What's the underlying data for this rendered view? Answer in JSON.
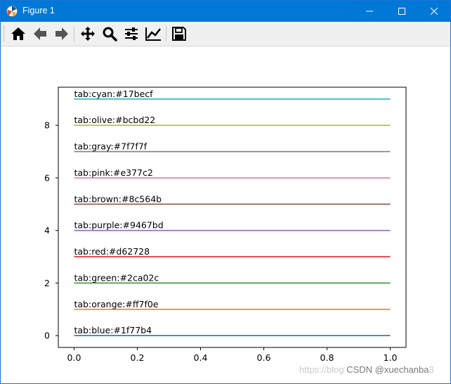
{
  "window": {
    "title": "Figure 1"
  },
  "toolbar": {
    "buttons": [
      {
        "name": "home-icon",
        "label": "Home"
      },
      {
        "name": "back-arrow-icon",
        "label": "Back"
      },
      {
        "name": "forward-arrow-icon",
        "label": "Forward"
      },
      {
        "name": "pan-icon",
        "label": "Pan"
      },
      {
        "name": "zoom-icon",
        "label": "Zoom"
      },
      {
        "name": "configure-subplots-icon",
        "label": "Subplots"
      },
      {
        "name": "edit-axis-icon",
        "label": "Customize"
      },
      {
        "name": "save-icon",
        "label": "Save"
      }
    ]
  },
  "chart_data": {
    "type": "line",
    "title": "",
    "xlabel": "",
    "ylabel": "",
    "xlim": [
      -0.05,
      1.05
    ],
    "ylim": [
      -0.45,
      9.45
    ],
    "x_ticks": [
      "0.0",
      "0.2",
      "0.4",
      "0.6",
      "0.8",
      "1.0"
    ],
    "x_tick_values": [
      0.0,
      0.2,
      0.4,
      0.6,
      0.8,
      1.0
    ],
    "y_ticks": [
      "0",
      "2",
      "4",
      "6",
      "8"
    ],
    "y_tick_values": [
      0,
      2,
      4,
      6,
      8
    ],
    "grid": false,
    "legend": "none",
    "series": [
      {
        "label": "tab:blue:#1f77b4",
        "color": "#1f77b4",
        "x": [
          0,
          1
        ],
        "y": [
          0,
          0
        ]
      },
      {
        "label": "tab:orange:#ff7f0e",
        "color": "#ff7f0e",
        "x": [
          0,
          1
        ],
        "y": [
          1,
          1
        ]
      },
      {
        "label": "tab:green:#2ca02c",
        "color": "#2ca02c",
        "x": [
          0,
          1
        ],
        "y": [
          2,
          2
        ]
      },
      {
        "label": "tab:red:#d62728",
        "color": "#d62728",
        "x": [
          0,
          1
        ],
        "y": [
          3,
          3
        ]
      },
      {
        "label": "tab:purple:#9467bd",
        "color": "#9467bd",
        "x": [
          0,
          1
        ],
        "y": [
          4,
          4
        ]
      },
      {
        "label": "tab:brown:#8c564b",
        "color": "#8c564b",
        "x": [
          0,
          1
        ],
        "y": [
          5,
          5
        ]
      },
      {
        "label": "tab:pink:#e377c2",
        "color": "#e377c2",
        "x": [
          0,
          1
        ],
        "y": [
          6,
          6
        ]
      },
      {
        "label": "tab:gray:#7f7f7f",
        "color": "#7f7f7f",
        "x": [
          0,
          1
        ],
        "y": [
          7,
          7
        ]
      },
      {
        "label": "tab:olive:#bcbd22",
        "color": "#bcbd22",
        "x": [
          0,
          1
        ],
        "y": [
          8,
          8
        ]
      },
      {
        "label": "tab:cyan:#17becf",
        "color": "#17becf",
        "x": [
          0,
          1
        ],
        "y": [
          9,
          9
        ]
      }
    ]
  },
  "watermark": {
    "prefix": "https://blog",
    "site": "CSDN @xuechanba",
    "suffix": "3"
  },
  "colors": {
    "titlebar": "#0078d7",
    "toolbar": "#f0f0f0"
  }
}
